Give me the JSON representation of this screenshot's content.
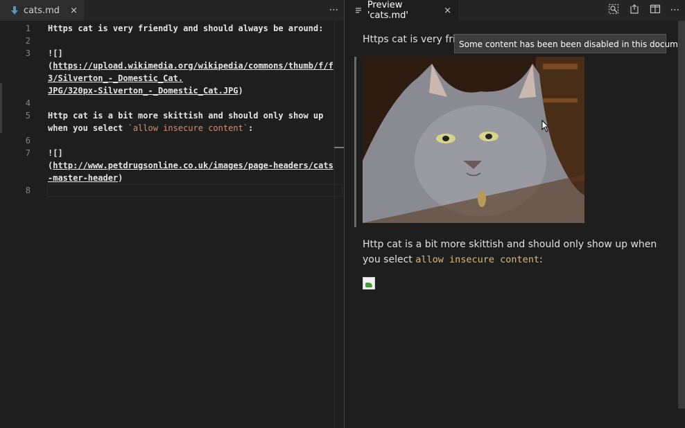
{
  "editor": {
    "tab_label": "cats.md",
    "close_glyph": "×",
    "more_glyph": "···",
    "lines": [
      {
        "n": "1",
        "text": "Https cat is very friendly and should always be around:"
      },
      {
        "n": "2",
        "text": ""
      },
      {
        "n": "3",
        "text": "![]"
      },
      {
        "n": "",
        "text": "(",
        "url": "https://upload.wikimedia.org/wikipedia/commons/thumb/f/f"
      },
      {
        "n": "",
        "url": "3/Silverton_-_Domestic_Cat."
      },
      {
        "n": "",
        "url": "JPG/320px-Silverton_-_Domestic_Cat.JPG",
        "tail": ")"
      },
      {
        "n": "4",
        "text": ""
      },
      {
        "n": "5",
        "text": "Http cat is a bit more skittish and should only show up"
      },
      {
        "n": "",
        "text": "when you select ",
        "inline": "`allow insecure content`",
        "tail": ":"
      },
      {
        "n": "6",
        "text": ""
      },
      {
        "n": "7",
        "text": "![]"
      },
      {
        "n": "",
        "text": "(",
        "url": "http://www.petdrugsonline.co.uk/images/page-headers/cats"
      },
      {
        "n": "",
        "url": "-master-header",
        "tail": ")"
      },
      {
        "n": "8",
        "text": ""
      }
    ]
  },
  "preview": {
    "tab_label": "Preview 'cats.md'",
    "close_glyph": "×",
    "para1": "Https cat is very frie",
    "tooltip": "Some content has been been disabled in this document",
    "para2_start": "Http cat is a bit more skittish and should only show up when you select ",
    "para2_code": "allow insecure content",
    "para2_end": ":",
    "actions": [
      "search-preview-icon",
      "open-source-icon",
      "split-editor-icon",
      "more-icon"
    ],
    "more_glyph": "···"
  }
}
